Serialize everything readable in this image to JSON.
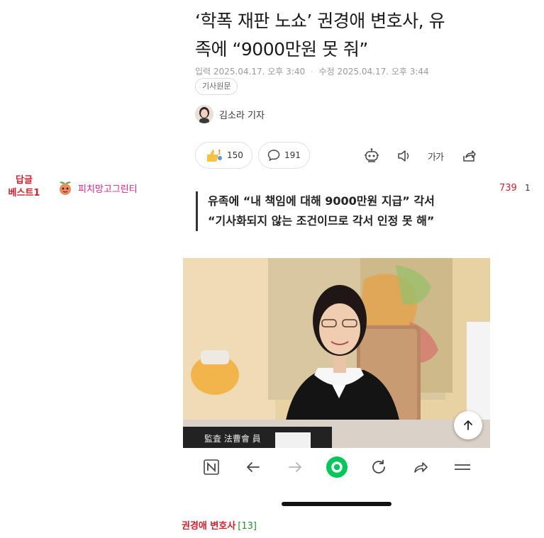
{
  "sidebar": {
    "best_badge_line1": "답글",
    "best_badge_line2": "베스트1",
    "author_name": "피치망고그린티",
    "views": "739",
    "recommend_count": "1"
  },
  "article": {
    "headline_line1": "‘학폭 재판 노쇼’ 권경애 변호사, 유",
    "headline_line2": "족에 “9000만원 못 줘”",
    "input_label": "입력",
    "input_date": "2025.04.17. 오후 3:40",
    "edit_label": "수정",
    "edit_date": "2025.04.17. 오후 3:44",
    "original_button": "기사원문",
    "reporter": "김소라 기자",
    "like_count": "150",
    "comment_count": "191",
    "font_size_label": "가가",
    "quote_line1": "유족에 “내 책임에 대해 9000만원 지급” 각서",
    "quote_line2": "“기사화되지 않는 조건이므로 각서 인정 못 해”"
  },
  "browser_nav": {
    "icons": [
      "naver-n-icon",
      "back-arrow-icon",
      "forward-arrow-icon",
      "green-home-icon",
      "refresh-icon",
      "share-icon",
      "menu-icon"
    ],
    "accent_color": "#03c75a"
  },
  "footer": {
    "board_link_name": "권경애 변호사",
    "board_link_count": "[13]"
  },
  "colors": {
    "best_red": "#d0202e",
    "author_pink": "#e0208a",
    "count_green": "#2f8a2f"
  }
}
